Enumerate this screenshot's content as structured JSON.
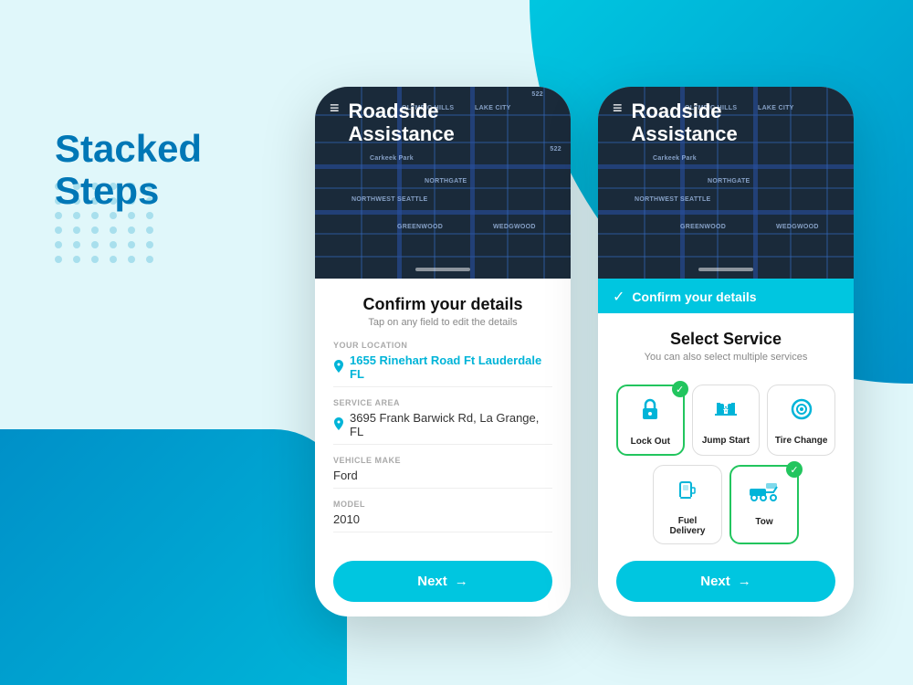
{
  "page": {
    "title_line1": "Stacked",
    "title_line2": "Steps",
    "bg_accent": "#00c6e0",
    "bg_light": "#e0f7fa"
  },
  "phone1": {
    "map_title_line1": "Roadside",
    "map_title_line2": "Assistance",
    "hamburger": "≡",
    "card_title": "Confirm your details",
    "card_subtitle": "Tap on any field to edit the details",
    "fields": [
      {
        "label": "YOUR LOCATION",
        "value": "1655  Rinehart Road Ft Lauderdale FL",
        "accent": true,
        "icon": "📍"
      },
      {
        "label": "SERVICE AREA",
        "value": "3695 Frank Barwick Rd, La Grange, FL",
        "accent": false,
        "icon": "📍"
      },
      {
        "label": "VEHICLE MAKE",
        "value": "Ford",
        "accent": false,
        "icon": ""
      },
      {
        "label": "MODEL",
        "value": "2010",
        "accent": false,
        "icon": ""
      }
    ],
    "next_btn": "Next",
    "next_arrow": "→"
  },
  "phone2": {
    "map_title_line1": "Roadside",
    "map_title_line2": "Assistance",
    "hamburger": "≡",
    "step_bar_label": "Confirm your details",
    "card_title": "Select Service",
    "card_subtitle": "You can also select multiple services",
    "services_row1": [
      {
        "label": "Lock Out",
        "selected": true,
        "icon": "🔑"
      },
      {
        "label": "Jump Start",
        "selected": false,
        "icon": "🔋"
      },
      {
        "label": "Tire Change",
        "selected": false,
        "icon": "🛞"
      }
    ],
    "services_row2": [
      {
        "label": "Fuel Delivery",
        "selected": false,
        "icon": "⛽"
      },
      {
        "label": "Tow",
        "selected": true,
        "icon": "🚗"
      }
    ],
    "next_btn": "Next",
    "next_arrow": "→"
  }
}
